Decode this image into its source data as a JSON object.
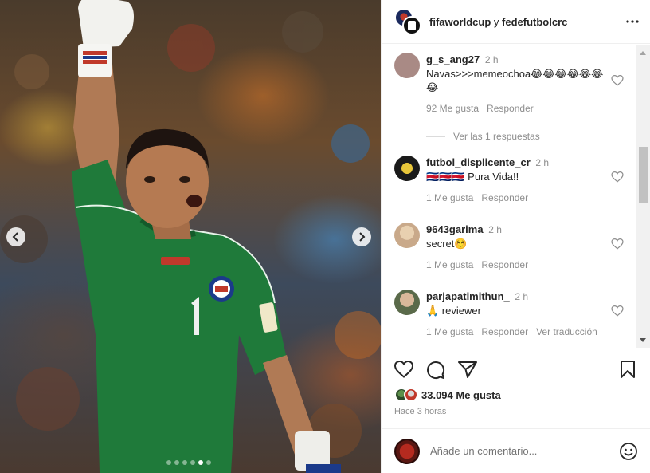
{
  "post": {
    "header": {
      "account_primary": "fifaworldcup",
      "connector": "y",
      "account_secondary": "fedefutbolcrc",
      "more_icon": "more-horizontal-icon"
    },
    "carousel": {
      "slide_count": 6,
      "active_slide": 5
    },
    "comments": [
      {
        "username": "g_s_ang27",
        "time": "2 h",
        "text": "Navas>>>memeochoa😂😂😂😂😂😂😂",
        "likes": "92 Me gusta",
        "reply_label": "Responder",
        "avatar_color": "#a98a85"
      },
      {
        "username": "futbol_displicente_cr",
        "time": "2 h",
        "text": "🇨🇷🇨🇷🇨🇷 Pura Vida!!",
        "likes": "1 Me gusta",
        "reply_label": "Responder",
        "avatar_color": "#1a1a1a"
      },
      {
        "username": "9643garima",
        "time": "2 h",
        "text": "secret☺️",
        "likes": "1 Me gusta",
        "reply_label": "Responder",
        "avatar_color": "#c9a98a"
      },
      {
        "username": "parjapatimithun_",
        "time": "2 h",
        "text": "🙏 reviewer",
        "likes": "1 Me gusta",
        "reply_label": "Responder",
        "translate_label": "Ver traducción",
        "avatar_color": "#8a9a7a"
      }
    ],
    "view_replies": "Ver las 1 respuestas",
    "like_count": "33.094 Me gusta",
    "time_ago": "Hace 3 horas",
    "comment_placeholder": "Añade un comentario...",
    "colors": {
      "text": "#262626",
      "secondary": "#8e8e8e",
      "jersey_green": "#1f7a3a"
    }
  }
}
